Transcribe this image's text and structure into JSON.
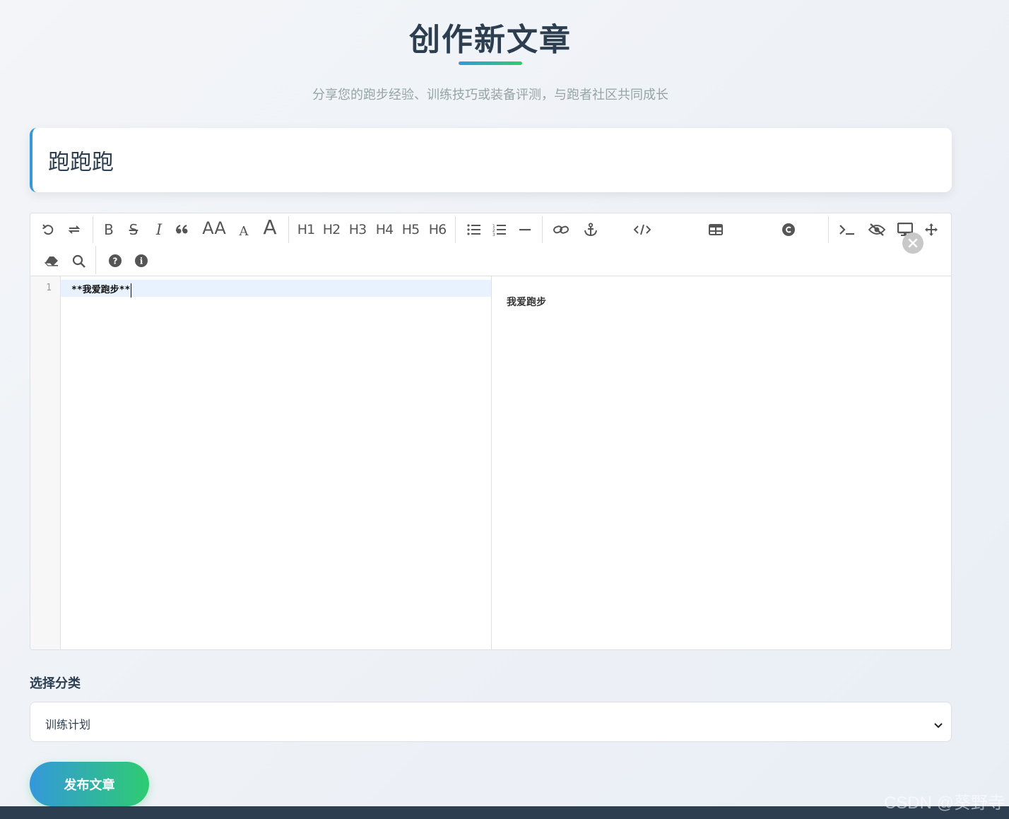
{
  "header": {
    "title": "创作新文章",
    "subtitle": "分享您的跑步经验、训练技巧或装备评测，与跑者社区共同成长"
  },
  "article": {
    "title_value": "跑跑跑"
  },
  "toolbar": {
    "heading_small": "A",
    "heading_large": "A",
    "uppercase": "AA",
    "h1": "H1",
    "h2": "H2",
    "h3": "H3",
    "h4": "H4",
    "h5": "H5",
    "h6": "H6",
    "bold": "B",
    "italic": "I",
    "strike": "S"
  },
  "editor": {
    "line_number": "1",
    "code_line": "**我爱跑步**",
    "preview_text": "我爱跑步"
  },
  "category": {
    "label": "选择分类",
    "selected": "训练计划"
  },
  "actions": {
    "publish": "发布文章"
  },
  "watermark": "CSDN @葵野寺",
  "colors": {
    "accent_blue": "#3498db",
    "accent_green": "#2ecc71",
    "text_dark": "#2c3e50",
    "footer": "#2c3e50"
  }
}
